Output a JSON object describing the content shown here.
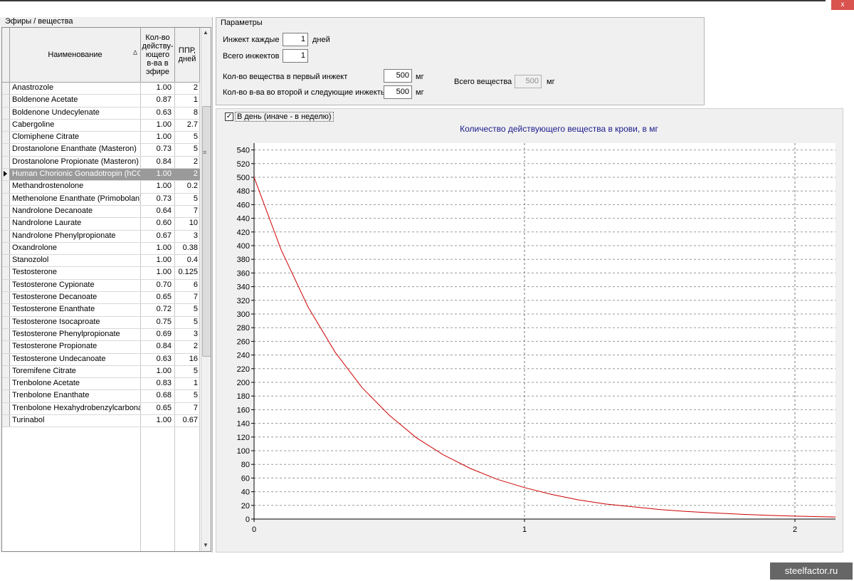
{
  "window": {
    "close_glyph": "x"
  },
  "left_panel": {
    "title": "Эфиры / вещества",
    "columns": {
      "name": "Наименование",
      "amount": "Кол-во\nдейству-\nющего\nв-ва в\nэфире",
      "ppr": "ППР,\nдней"
    },
    "sort_icon": "sort-indicator-icon",
    "selected_index": 7,
    "rows": [
      [
        "Anastrozole",
        "1.00",
        "2"
      ],
      [
        "Boldenone Acetate",
        "0.87",
        "1"
      ],
      [
        "Boldenone Undecylenate",
        "0.63",
        "8"
      ],
      [
        "Cabergoline",
        "1.00",
        "2.7"
      ],
      [
        "Clomiphene Citrate",
        "1.00",
        "5"
      ],
      [
        "Drostanolone Enanthate (Masteron)",
        "0.73",
        "5"
      ],
      [
        "Drostanolone Propionate (Masteron)",
        "0.84",
        "2"
      ],
      [
        "Human Chorionic Gonadotropin (hCG)",
        "1.00",
        "2"
      ],
      [
        "Methandrostenolone",
        "1.00",
        "0.2"
      ],
      [
        "Methenolone Enanthate (Primobolan)",
        "0.73",
        "5"
      ],
      [
        "Nandrolone Decanoate",
        "0.64",
        "7"
      ],
      [
        "Nandrolone Laurate",
        "0.60",
        "10"
      ],
      [
        "Nandrolone Phenylpropionate",
        "0.67",
        "3"
      ],
      [
        "Oxandrolone",
        "1.00",
        "0.38"
      ],
      [
        "Stanozolol",
        "1.00",
        "0.4"
      ],
      [
        "Testosterone",
        "1.00",
        "0.125"
      ],
      [
        "Testosterone Cypionate",
        "0.70",
        "6"
      ],
      [
        "Testosterone Decanoate",
        "0.65",
        "7"
      ],
      [
        "Testosterone Enanthate",
        "0.72",
        "5"
      ],
      [
        "Testosterone Isocaproate",
        "0.75",
        "5"
      ],
      [
        "Testosterone Phenylpropionate",
        "0.69",
        "3"
      ],
      [
        "Testosterone Propionate",
        "0.84",
        "2"
      ],
      [
        "Testosterone Undecanoate",
        "0.63",
        "16"
      ],
      [
        "Toremifene Citrate",
        "1.00",
        "5"
      ],
      [
        "Trenbolone Acetate",
        "0.83",
        "1"
      ],
      [
        "Trenbolone Enanthate",
        "0.68",
        "5"
      ],
      [
        "Trenbolone Hexahydrobenzylcarbonate",
        "0.65",
        "7"
      ],
      [
        "Turinabol",
        "1.00",
        "0.67"
      ]
    ]
  },
  "params": {
    "title": "Параметры",
    "inject_every_label": "Инжект каждые",
    "inject_every_value": "1",
    "inject_every_unit": "дней",
    "total_injects_label": "Всего инжектов",
    "total_injects_value": "1",
    "first_inject_label": "Кол-во вещества в первый инжект",
    "first_inject_value": "500",
    "first_inject_unit": "мг",
    "next_inject_label": "Кол-во в-ва во второй и следующие инжекты",
    "next_inject_value": "500",
    "next_inject_unit": "мг",
    "total_substance_label": "Всего вещества",
    "total_substance_value": "500",
    "total_substance_unit": "мг"
  },
  "chart_options": {
    "per_day_checkbox_label": "В день (иначе - в неделю)",
    "per_day_checked": true
  },
  "chart_data": {
    "type": "line",
    "title": "Количество действующего вещества в крови, в мг",
    "xlim": [
      0,
      2.15
    ],
    "ylim": [
      0,
      550
    ],
    "x_ticks": [
      0,
      1,
      2
    ],
    "y_ticks": [
      0,
      20,
      40,
      60,
      80,
      100,
      120,
      140,
      160,
      180,
      200,
      220,
      240,
      260,
      280,
      300,
      320,
      340,
      360,
      380,
      400,
      420,
      440,
      460,
      480,
      500,
      520,
      540
    ],
    "series": [
      {
        "color": "#cc0000",
        "x": [
          0,
          0.1,
          0.2,
          0.3,
          0.4,
          0.5,
          0.6,
          0.7,
          0.8,
          0.9,
          1.0,
          1.1,
          1.2,
          1.3,
          1.4,
          1.5,
          1.6,
          1.7,
          1.8,
          1.9,
          2.0,
          2.1,
          2.15
        ],
        "y": [
          500,
          394,
          310,
          244,
          192,
          152,
          119,
          94,
          74,
          58,
          46,
          36,
          28,
          22,
          18,
          14,
          11,
          9,
          7,
          5.5,
          4.3,
          3.4,
          3
        ]
      }
    ],
    "grid": true,
    "line_color": "#cc0000",
    "title_color": "#1a1a8c"
  },
  "watermark": "steelfactor.ru"
}
